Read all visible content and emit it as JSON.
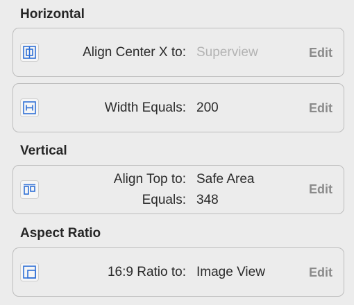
{
  "sections": {
    "horizontal": {
      "title": "Horizontal",
      "rows": [
        {
          "icon": "align-center-x-icon",
          "label": "Align Center X to:",
          "value": "Superview",
          "edit": "Edit"
        },
        {
          "icon": "width-icon",
          "label": "Width Equals:",
          "value": "200",
          "edit": "Edit"
        }
      ]
    },
    "vertical": {
      "title": "Vertical",
      "rows": [
        {
          "icon": "align-top-icon",
          "label": "Align Top to:",
          "value": "Safe Area",
          "label2": "Equals:",
          "value2": "348",
          "edit": "Edit"
        }
      ]
    },
    "aspect": {
      "title": "Aspect Ratio",
      "rows": [
        {
          "icon": "aspect-ratio-icon",
          "label": "16:9 Ratio to:",
          "value": "Image View",
          "edit": "Edit"
        }
      ]
    }
  },
  "colors": {
    "icon_blue": "#2f6fd6",
    "placeholder_gray": "#b3b3b3",
    "edit_gray": "#8a8a8a"
  }
}
